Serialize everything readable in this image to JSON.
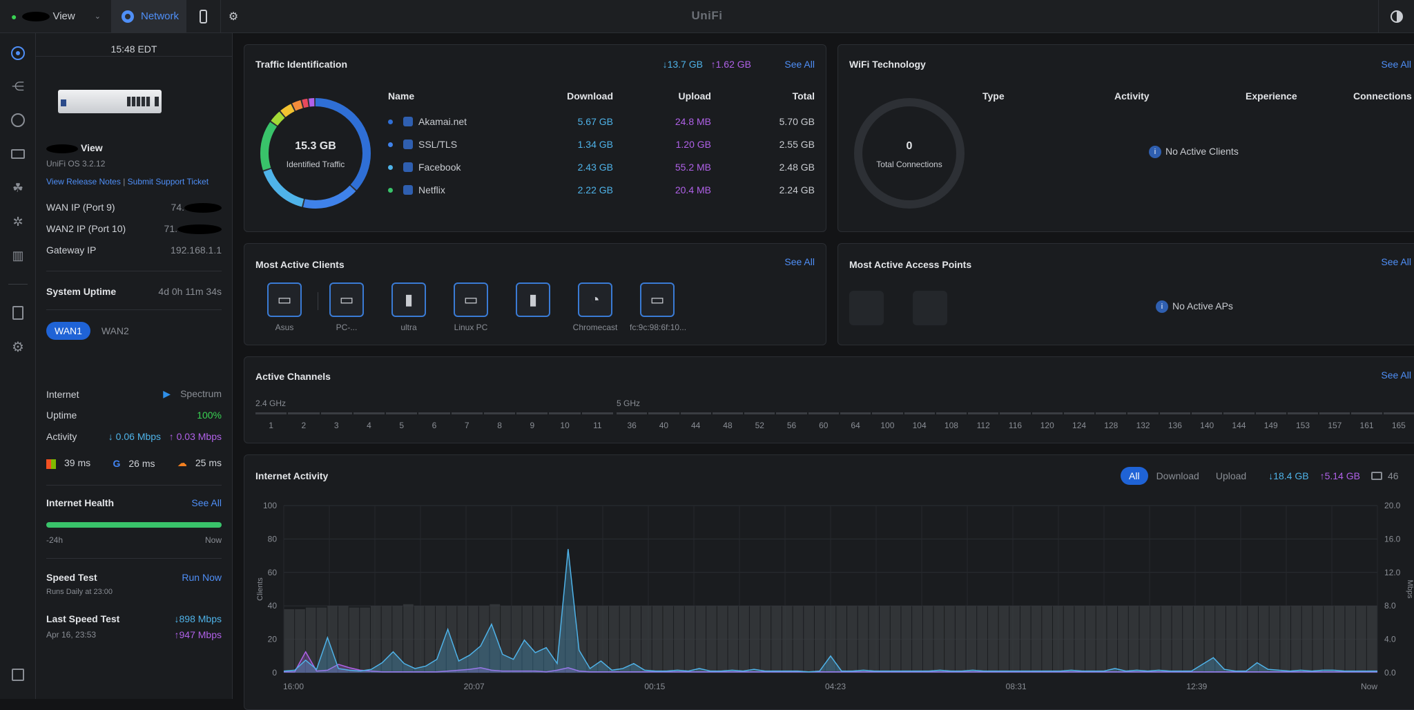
{
  "topbar": {
    "site_label": "View",
    "network_label": "Network",
    "app_title": "UniFi"
  },
  "console": {
    "time": "15:48 EDT",
    "name": "View",
    "os_version": "UniFi OS 3.2.12",
    "release_notes_link": "View Release Notes",
    "separator": "|",
    "support_link": "Submit Support Ticket",
    "wan_ip_label": "WAN IP (Port 9)",
    "wan_ip_value": "74.",
    "wan2_ip_label": "WAN2 IP (Port 10)",
    "wan2_ip_value": "71.",
    "gateway_label": "Gateway IP",
    "gateway_value": "192.168.1.1",
    "uptime_label": "System Uptime",
    "uptime_value": "4d 0h 11m 34s"
  },
  "wan": {
    "tabs": [
      "WAN1",
      "WAN2"
    ],
    "internet_label": "Internet",
    "isp": "Spectrum",
    "uptime_label": "Uptime",
    "uptime_value": "100%",
    "activity_label": "Activity",
    "activity_down": "↓ 0.06 Mbps",
    "activity_up": "↑ 0.03 Mbps",
    "latency": [
      {
        "service": "microsoft",
        "value": "39 ms"
      },
      {
        "service": "google",
        "value": "26 ms"
      },
      {
        "service": "cloudflare",
        "value": "25 ms"
      }
    ]
  },
  "health": {
    "title": "Internet Health",
    "see_all": "See All",
    "start": "-24h",
    "end": "Now",
    "level": 1.0
  },
  "speed_test": {
    "title": "Speed Test",
    "run_now": "Run Now",
    "schedule": "Runs Daily at 23:00",
    "last_label": "Last Speed Test",
    "last_date": "Apr 16, 23:53",
    "down": "↓898 Mbps",
    "up": "↑947 Mbps"
  },
  "traffic": {
    "title": "Traffic Identification",
    "total_down": "↓13.7 GB",
    "total_up": "↑1.62 GB",
    "see_all": "See All",
    "donut_value": "15.3 GB",
    "donut_label": "Identified Traffic",
    "headers": [
      "Name",
      "Download",
      "Upload",
      "Total"
    ],
    "rows": [
      {
        "name": "Akamai.net",
        "download": "5.67 GB",
        "upload": "24.8 MB",
        "total": "5.70 GB",
        "color": "#2f6fd6"
      },
      {
        "name": "SSL/TLS",
        "download": "1.34 GB",
        "upload": "1.20 GB",
        "total": "2.55 GB",
        "color": "#3f82ea"
      },
      {
        "name": "Facebook",
        "download": "2.43 GB",
        "upload": "55.2 MB",
        "total": "2.48 GB",
        "color": "#4fb3e9"
      },
      {
        "name": "Netflix",
        "download": "2.22 GB",
        "upload": "20.4 MB",
        "total": "2.24 GB",
        "color": "#39c36a"
      }
    ]
  },
  "wifi": {
    "title": "WiFi Technology",
    "see_all": "See All",
    "donut_value": "0",
    "donut_label": "Total Connections",
    "headers": [
      "Type",
      "Activity",
      "Experience",
      "Connections"
    ],
    "empty": "No Active Clients"
  },
  "clients": {
    "title": "Most Active Clients",
    "see_all": "See All",
    "items": [
      {
        "label": "Asus",
        "icon": "desktop-icon"
      },
      {
        "label": "PC-...",
        "icon": "desktop-icon"
      },
      {
        "label": "ultra",
        "icon": "phone-icon"
      },
      {
        "label": "Linux PC",
        "icon": "desktop-icon"
      },
      {
        "label": "",
        "icon": "phone-icon"
      },
      {
        "label": "Chromecast",
        "icon": "chromecast-icon"
      },
      {
        "label": "fc:9c:98:6f:10...",
        "icon": "monitor-icon"
      }
    ]
  },
  "aps": {
    "title": "Most Active Access Points",
    "see_all": "See All",
    "empty": "No Active APs"
  },
  "channels": {
    "title": "Active Channels",
    "see_all": "See All",
    "band_24": "2.4 GHz",
    "band_5": "5 GHz",
    "ch_24": [
      "1",
      "2",
      "3",
      "4",
      "5",
      "6",
      "7",
      "8",
      "9",
      "10",
      "11"
    ],
    "ch_5": [
      "36",
      "40",
      "44",
      "48",
      "52",
      "56",
      "60",
      "64",
      "100",
      "104",
      "108",
      "112",
      "116",
      "120",
      "124",
      "128",
      "132",
      "136",
      "140",
      "144",
      "149",
      "153",
      "157",
      "161",
      "165"
    ]
  },
  "activity": {
    "title": "Internet Activity",
    "filters": [
      "All",
      "Download",
      "Upload"
    ],
    "total_down": "↓18.4 GB",
    "total_up": "↑5.14 GB",
    "clients_count": "46"
  },
  "chart_data": {
    "type": "area",
    "x_ticks": [
      "16:00",
      "20:07",
      "00:15",
      "04:23",
      "08:31",
      "12:39",
      "Now"
    ],
    "ylabel": "Clients",
    "y2label": "Mbps",
    "ylim": [
      0,
      100
    ],
    "y_ticks": [
      "0",
      "20",
      "40",
      "60",
      "80",
      "100"
    ],
    "y2lim": [
      0,
      20
    ],
    "y2_ticks": [
      "0.0",
      "4.0",
      "8.0",
      "12.0",
      "16.0",
      "20.0"
    ],
    "series": [
      {
        "name": "Clients",
        "color": "#5a5d63",
        "values": [
          38,
          38,
          39,
          39,
          40,
          40,
          39,
          39,
          40,
          40,
          40,
          41,
          40,
          40,
          40,
          40,
          40,
          40,
          40,
          41,
          40,
          40,
          40,
          40,
          40,
          40,
          40,
          40,
          40,
          40,
          40,
          40,
          40,
          40,
          40,
          40,
          40,
          40,
          40,
          40,
          40,
          40,
          40,
          40,
          40,
          40,
          40,
          40,
          40,
          40,
          40,
          40,
          40,
          40,
          40,
          40,
          40,
          40,
          40,
          40,
          40,
          40,
          40,
          40,
          40,
          40,
          40,
          40,
          40,
          40,
          40,
          40,
          40,
          40,
          40,
          40,
          40,
          40,
          40,
          40,
          40,
          40,
          40,
          40,
          40,
          40,
          40,
          40,
          40,
          40,
          40,
          40,
          40,
          40,
          40,
          40,
          40,
          40,
          40,
          40,
          40
        ]
      },
      {
        "name": "Download",
        "color": "#4fb3e9",
        "values": [
          0.2,
          0.3,
          1.5,
          0.4,
          4.2,
          0.5,
          0.3,
          0.2,
          0.4,
          1.2,
          2.5,
          1.1,
          0.5,
          0.8,
          1.6,
          5.2,
          1.4,
          2.1,
          3.2,
          5.8,
          2.2,
          1.6,
          3.9,
          2.4,
          3.0,
          1.1,
          14.8,
          2.7,
          0.5,
          1.4,
          0.3,
          0.5,
          1.1,
          0.3,
          0.2,
          0.2,
          0.3,
          0.2,
          0.5,
          0.2,
          0.2,
          0.3,
          0.2,
          0.4,
          0.2,
          0.2,
          0.2,
          0.2,
          0.1,
          0.2,
          2.0,
          0.2,
          0.2,
          0.3,
          0.2,
          0.2,
          0.2,
          0.2,
          0.2,
          0.2,
          0.3,
          0.2,
          0.2,
          0.3,
          0.2,
          0.2,
          0.2,
          0.2,
          0.2,
          0.2,
          0.2,
          0.2,
          0.3,
          0.2,
          0.2,
          0.2,
          0.5,
          0.2,
          0.3,
          0.2,
          0.3,
          0.2,
          0.2,
          0.2,
          1.0,
          1.8,
          0.4,
          0.2,
          0.2,
          1.2,
          0.4,
          0.3,
          0.2,
          0.3,
          0.2,
          0.3,
          0.3,
          0.2,
          0.2,
          0.2,
          0.2
        ]
      },
      {
        "name": "Upload",
        "color": "#b061e8",
        "values": [
          0.1,
          0.1,
          2.5,
          0.2,
          0.3,
          1.0,
          0.6,
          0.3,
          0.2,
          0.1,
          0.1,
          0.1,
          0.1,
          0.1,
          0.1,
          0.2,
          0.3,
          0.4,
          0.6,
          0.3,
          0.2,
          0.2,
          0.2,
          0.2,
          0.1,
          0.3,
          0.6,
          0.2,
          0.1,
          0.1,
          0.1,
          0.1,
          0.1,
          0.1,
          0.1,
          0.1,
          0.1,
          0.1,
          0.1,
          0.1,
          0.1,
          0.1,
          0.1,
          0.1,
          0.1,
          0.1,
          0.1,
          0.1,
          0.1,
          0.1,
          0.1,
          0.1,
          0.1,
          0.1,
          0.1,
          0.1,
          0.1,
          0.1,
          0.1,
          0.1,
          0.1,
          0.1,
          0.1,
          0.1,
          0.1,
          0.1,
          0.1,
          0.1,
          0.1,
          0.1,
          0.1,
          0.1,
          0.1,
          0.1,
          0.1,
          0.1,
          0.1,
          0.1,
          0.1,
          0.1,
          0.1,
          0.1,
          0.1,
          0.1,
          0.1,
          0.1,
          0.1,
          0.1,
          0.1,
          0.1,
          0.1,
          0.1,
          0.1,
          0.1,
          0.1,
          0.1,
          0.1,
          0.1,
          0.1,
          0.1,
          0.1
        ]
      }
    ]
  }
}
